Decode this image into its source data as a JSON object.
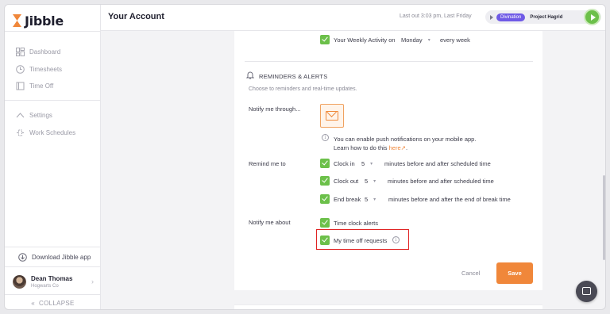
{
  "app": {
    "name": "Jibble"
  },
  "sidebar": {
    "items": [
      {
        "label": "Dashboard",
        "icon": "dashboard-icon"
      },
      {
        "label": "Timesheets",
        "icon": "clock-icon"
      },
      {
        "label": "Time Off",
        "icon": "time-off-icon"
      },
      {
        "label": "Settings",
        "icon": "chevron-up-icon"
      },
      {
        "label": "Work Schedules",
        "icon": "work-schedule-icon"
      }
    ],
    "download_label": "Download Jibble app",
    "user": {
      "name": "Dean Thomas",
      "org": "Hogwarts Co"
    },
    "collapse_label": "COLLAPSE"
  },
  "header": {
    "title": "Your Account",
    "last_out": "Last out 3:03 pm, Last Friday",
    "activity_badge": "Divination",
    "project": "Project Hagrid"
  },
  "weekly": {
    "label": "Your Weekly Activity on",
    "day": "Monday",
    "suffix": "every week"
  },
  "reminders": {
    "title": "REMINDERS & ALERTS",
    "subtitle": "Choose to reminders and real-time updates.",
    "notify_through_label": "Notify me through...",
    "push_note_line1": "You can enable push notifications on your mobile app.",
    "push_note_line2": "Learn how to do this",
    "push_note_link": "here",
    "remind_label": "Remind me to",
    "clock_in": {
      "label": "Clock in",
      "value": "5",
      "suffix": "minutes before and after scheduled time"
    },
    "clock_out": {
      "label": "Clock out",
      "value": "5",
      "suffix": "minutes before and after scheduled time"
    },
    "end_break": {
      "label": "End break",
      "value": "5",
      "suffix": "minutes before and after the end of break time"
    },
    "notify_about_label": "Notify me about",
    "time_clock_alerts": "Time clock alerts",
    "time_off_requests": "My time off requests"
  },
  "actions": {
    "cancel": "Cancel",
    "save": "Save"
  },
  "colors": {
    "accent": "#f0873a",
    "green": "#6cc04a",
    "purple": "#6f5ae6",
    "highlight": "#e02424"
  }
}
